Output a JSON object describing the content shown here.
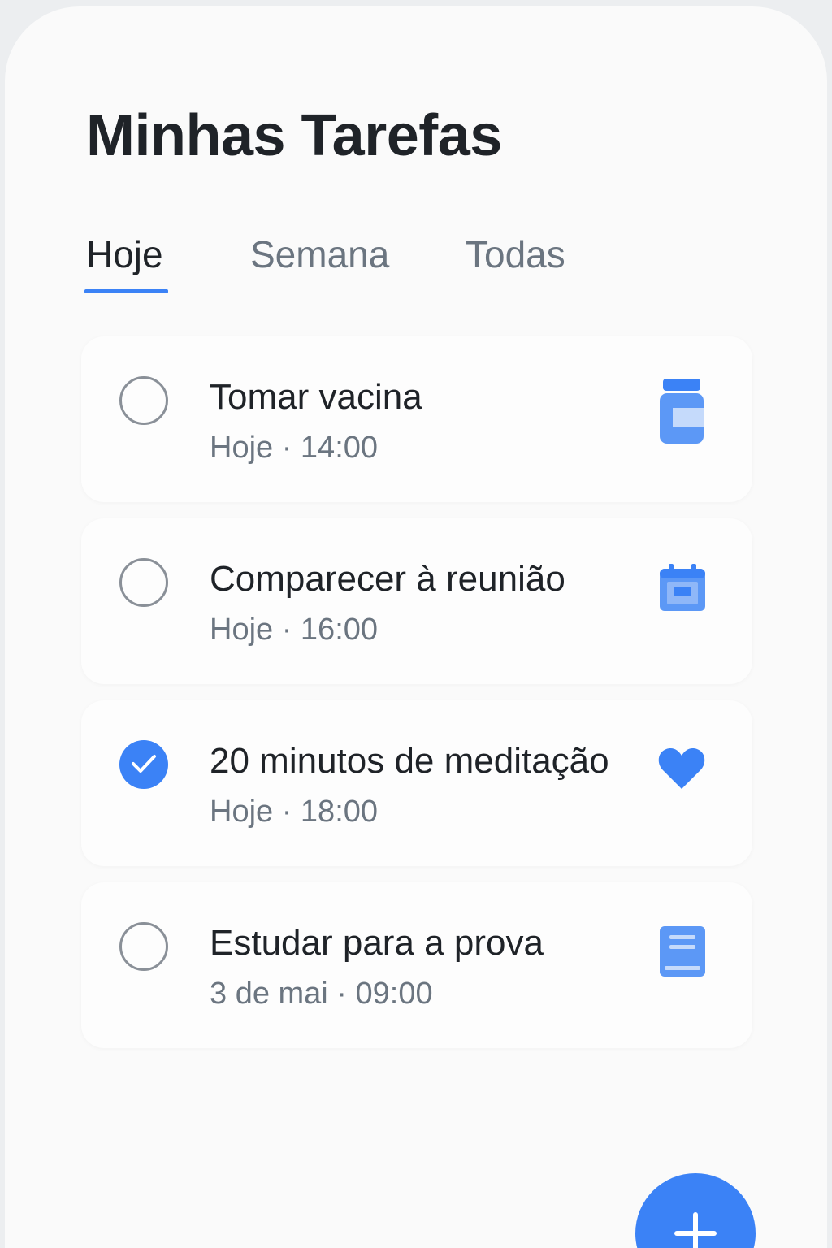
{
  "header": {
    "title": "Minhas Tarefas"
  },
  "tabs": [
    {
      "label": "Hoje",
      "active": true
    },
    {
      "label": "Semana",
      "active": false
    },
    {
      "label": "Todas",
      "active": false
    }
  ],
  "tasks": [
    {
      "title": "Tomar vacina",
      "meta": "Hoje · 14:00",
      "done": false,
      "icon": "vaccine-vial-icon"
    },
    {
      "title": "Comparecer à reunião",
      "meta": "Hoje · 16:00",
      "done": false,
      "icon": "calendar-icon"
    },
    {
      "title": "20 minutos de meditação",
      "meta": "Hoje · 18:00",
      "done": true,
      "icon": "heart-icon"
    },
    {
      "title": "Estudar para a prova",
      "meta": "3 de mai · 09:00",
      "done": false,
      "icon": "notebook-icon"
    }
  ],
  "fab": {
    "icon": "plus-icon"
  },
  "colors": {
    "accent": "#3B82F6",
    "text": "#1F2328",
    "muted": "#6B7580"
  }
}
